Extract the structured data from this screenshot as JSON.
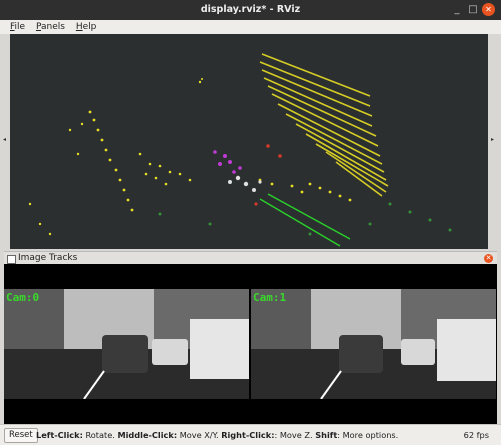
{
  "window": {
    "title": "display.rviz* - RViz"
  },
  "menu": {
    "items": [
      "File",
      "Panels",
      "Help"
    ],
    "mnemonics": [
      "F",
      "P",
      "H"
    ]
  },
  "panels": {
    "image_tracks_title": "Image Tracks"
  },
  "cameras": [
    {
      "label": "Cam:0"
    },
    {
      "label": "Cam:1"
    }
  ],
  "status": {
    "reset_label": "Reset",
    "help_parts": [
      {
        "text": "Left-Click:",
        "bold": true
      },
      {
        "text": " Rotate. ",
        "bold": false
      },
      {
        "text": "Middle-Click:",
        "bold": true
      },
      {
        "text": " Move X/Y. ",
        "bold": false
      },
      {
        "text": "Right-Click:",
        "bold": true
      },
      {
        "text": ": Move Z. ",
        "bold": false
      },
      {
        "text": "Shift",
        "bold": true
      },
      {
        "text": ": More options.",
        "bold": false
      }
    ],
    "fps": "62 fps"
  },
  "colors": {
    "titlebar": "#2f2f2f",
    "close": "#e95420",
    "points": "#e8dd24",
    "cam_label": "#38d92a"
  }
}
